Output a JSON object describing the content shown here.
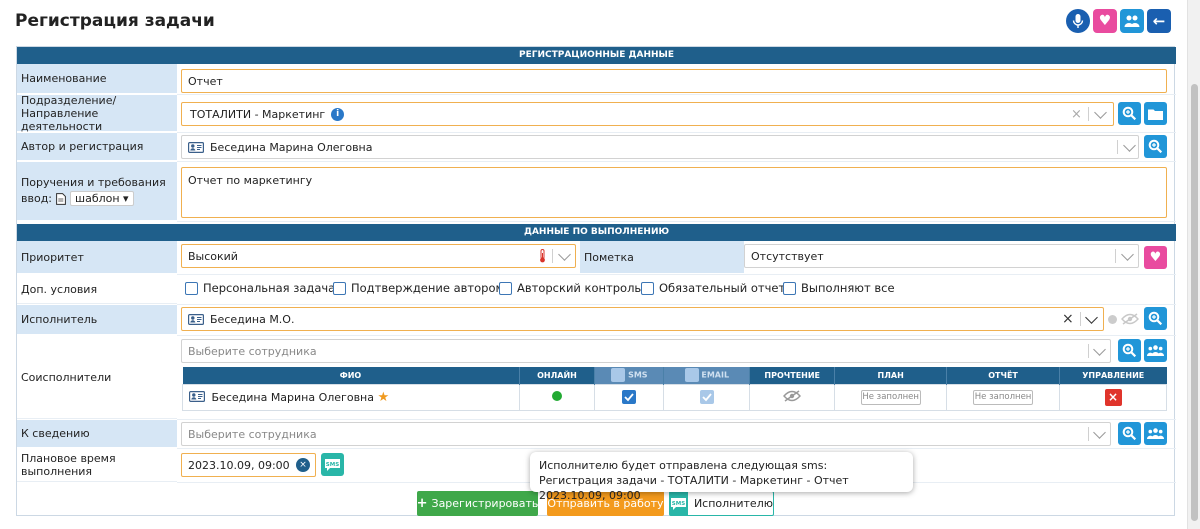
{
  "page": {
    "title": "Регистрация задачи"
  },
  "sections": {
    "registration": "РЕГИСТРАЦИОННЫЕ ДАННЫЕ",
    "execution": "ДАННЫЕ ПО ВЫПОЛНЕНИЮ"
  },
  "labels": {
    "name": "Наименование",
    "division_line1": "Подразделение/",
    "division_line2": "Направление деятельности",
    "author": "Автор и регистрация",
    "instructions_line1": "Поручения и требования",
    "instructions_line2": "ввод:",
    "priority": "Приоритет",
    "mark": "Пометка",
    "extra": "Доп. условия",
    "executor": "Исполнитель",
    "coexecutors": "Соисполнители",
    "info": "К сведению",
    "planned_time": "Плановое время выполнения"
  },
  "fields": {
    "name": "Отчет",
    "division": "ТОТАЛИТИ - Маркетинг",
    "author": "Беседина Марина Олеговна",
    "template": "шаблон",
    "instructions": "Отчет по маркетингу",
    "priority": "Высокий",
    "mark": "Отсутствует",
    "executor": "Беседина М.О.",
    "coexecutors_placeholder": "Выберите сотрудника",
    "info_placeholder": "Выберите сотрудника",
    "planned_time": "2023.10.09, 09:00"
  },
  "conditions": [
    "Персональная задача",
    "Подтверждение автором",
    "Авторский контроль",
    "Обязательный отчет",
    "Выполняют все"
  ],
  "coexecutor_table": {
    "headers": [
      "ФИО",
      "ОНЛАЙН",
      "SMS",
      "EMAIL",
      "ПРОЧТЕНИЕ",
      "ПЛАН",
      "ОТЧЁТ",
      "УПРАВЛЕНИЕ"
    ],
    "rows": [
      {
        "name": "Беседина Марина Олеговна",
        "plan": "Не заполнен",
        "report": "Не заполнен"
      }
    ]
  },
  "buttons": {
    "register": "Зарегистрировать",
    "send": "Отправить в работу",
    "to_executor": "Исполнителю"
  },
  "tooltip": {
    "line1": "Исполнителю будет отправлена следующая sms:",
    "line2": "Регистрация задачи - ТОТАЛИТИ - Маркетинг - Отчет 2023.10.09, 09:00"
  },
  "colors": {
    "header": "#1f5f8b",
    "label_bg": "#d6e6f5",
    "primary": "#2196d8",
    "register": "#3fa84a",
    "send": "#f39a1d",
    "sms": "#29b6a8",
    "delete": "#e0342b",
    "pink": "#e94b9f"
  }
}
